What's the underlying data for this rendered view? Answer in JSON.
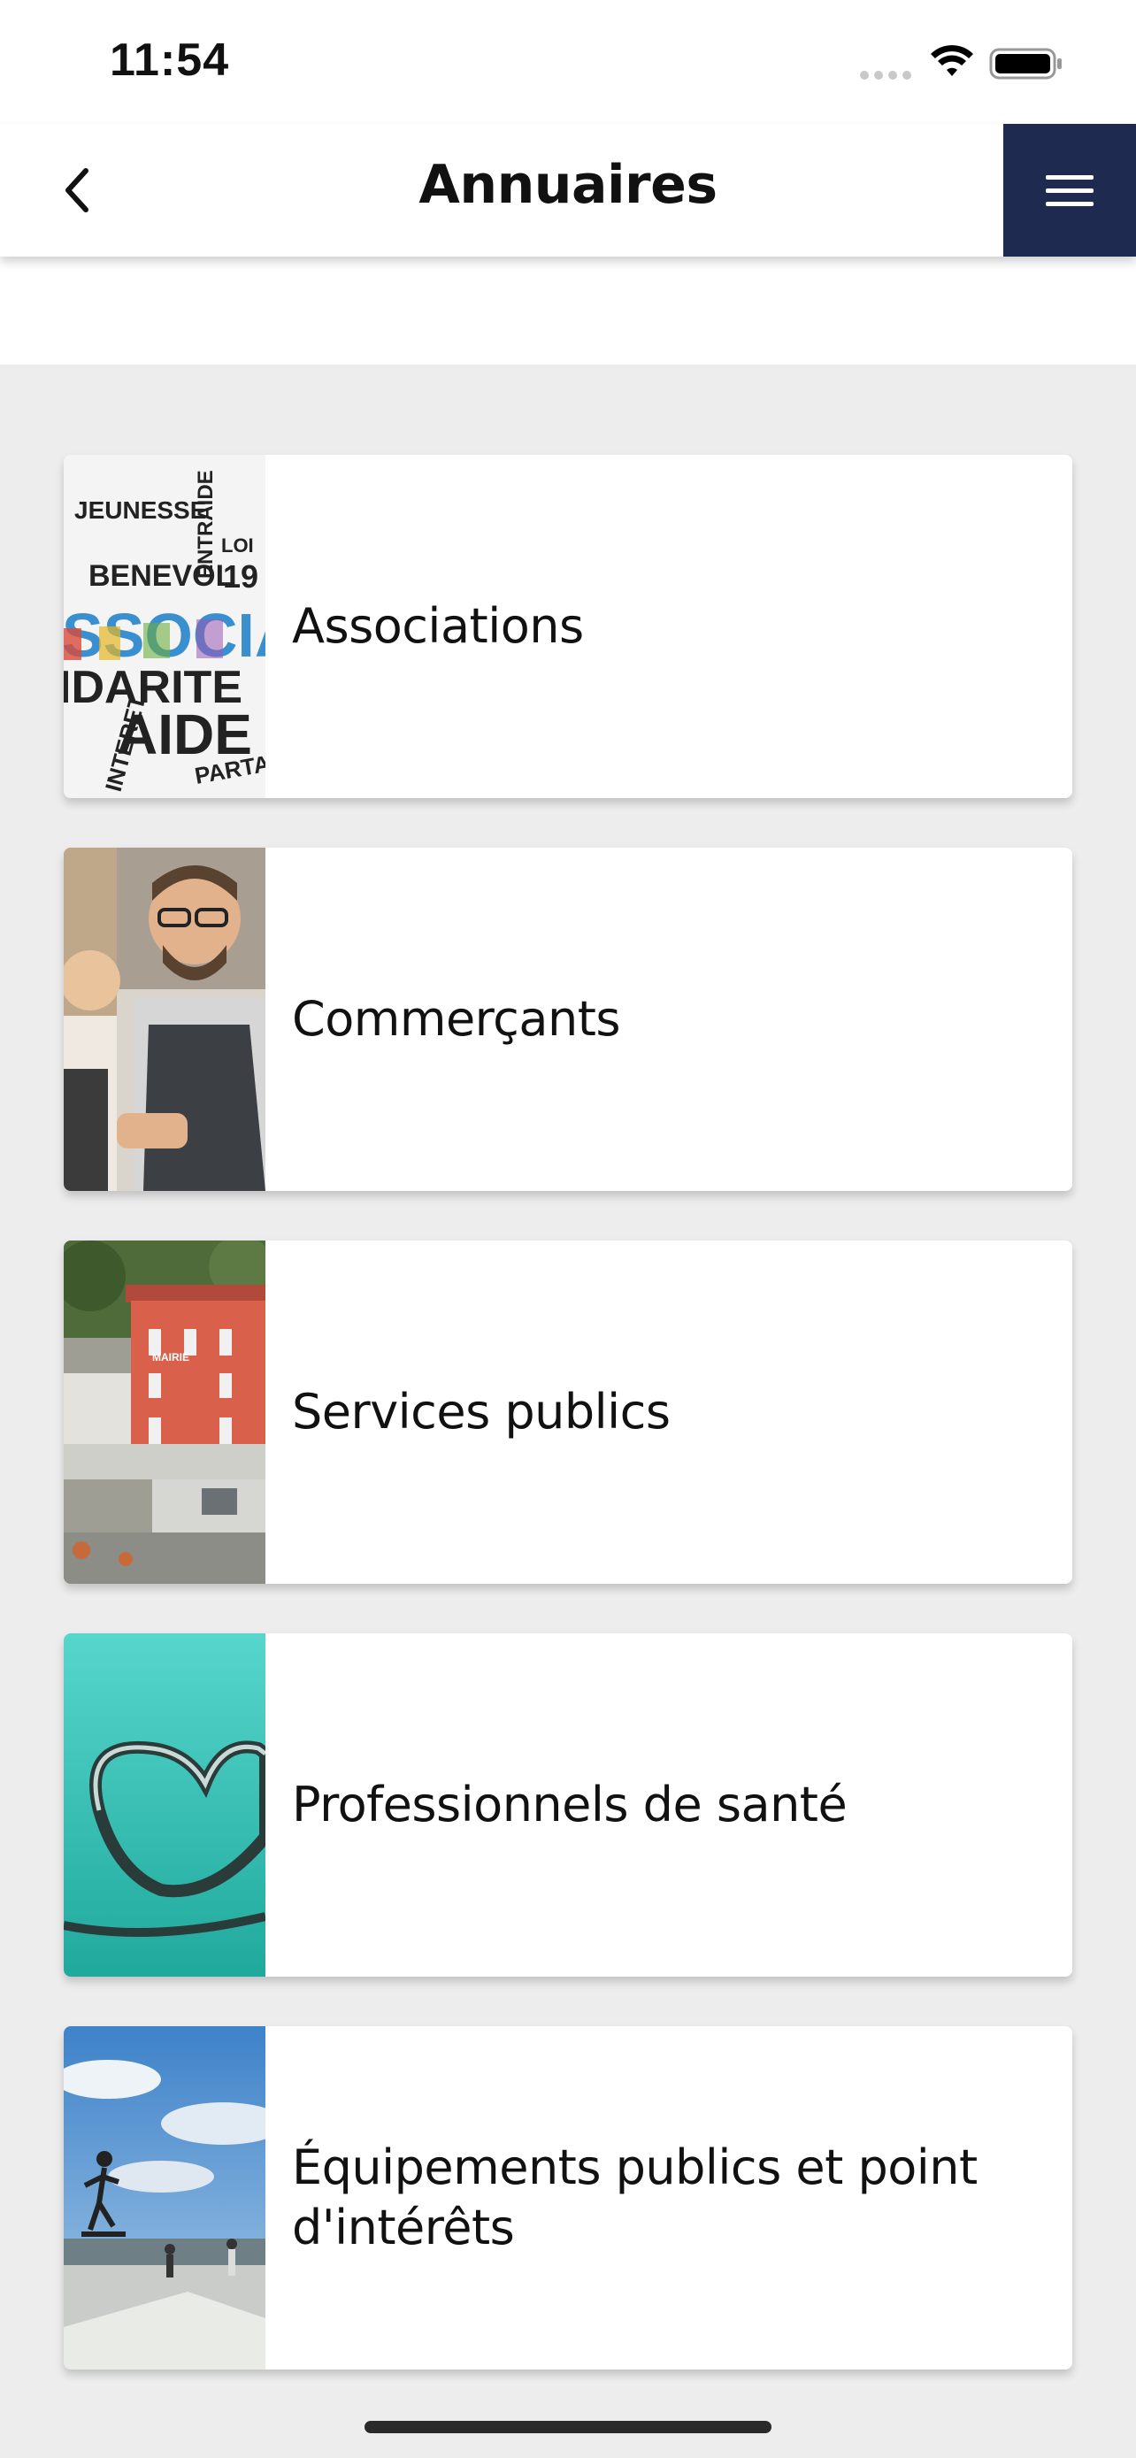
{
  "status_bar": {
    "time": "11:54",
    "icons": [
      "signal-dots-icon",
      "wifi-icon",
      "battery-icon"
    ]
  },
  "header": {
    "title": "Annuaires",
    "back_icon": "chevron-left-icon",
    "menu_icon": "hamburger-menu-icon",
    "menu_button_color": "#1e2a4f"
  },
  "categories": [
    {
      "label": "Associations",
      "image": "associations-word-cloud-image",
      "image_words": [
        "JEUNESSE",
        "BENEVOL",
        "SSOCIA",
        "IDARITE",
        "AIDE",
        "INTERET",
        "PARTA",
        "ENTRAIDE",
        "LOI",
        "19"
      ]
    },
    {
      "label": "Commerçants",
      "image": "shopkeeper-photo"
    },
    {
      "label": "Services publics",
      "image": "town-hall-photo",
      "image_words": [
        "MAIRIE"
      ]
    },
    {
      "label": "Professionnels de santé",
      "image": "stethoscope-heart-photo"
    },
    {
      "label": "Équipements publics et point d'intérêts",
      "image": "skatepark-photo"
    }
  ],
  "colors": {
    "background": "#ededed",
    "card": "#ffffff",
    "accent_navy": "#1e2a4f"
  }
}
